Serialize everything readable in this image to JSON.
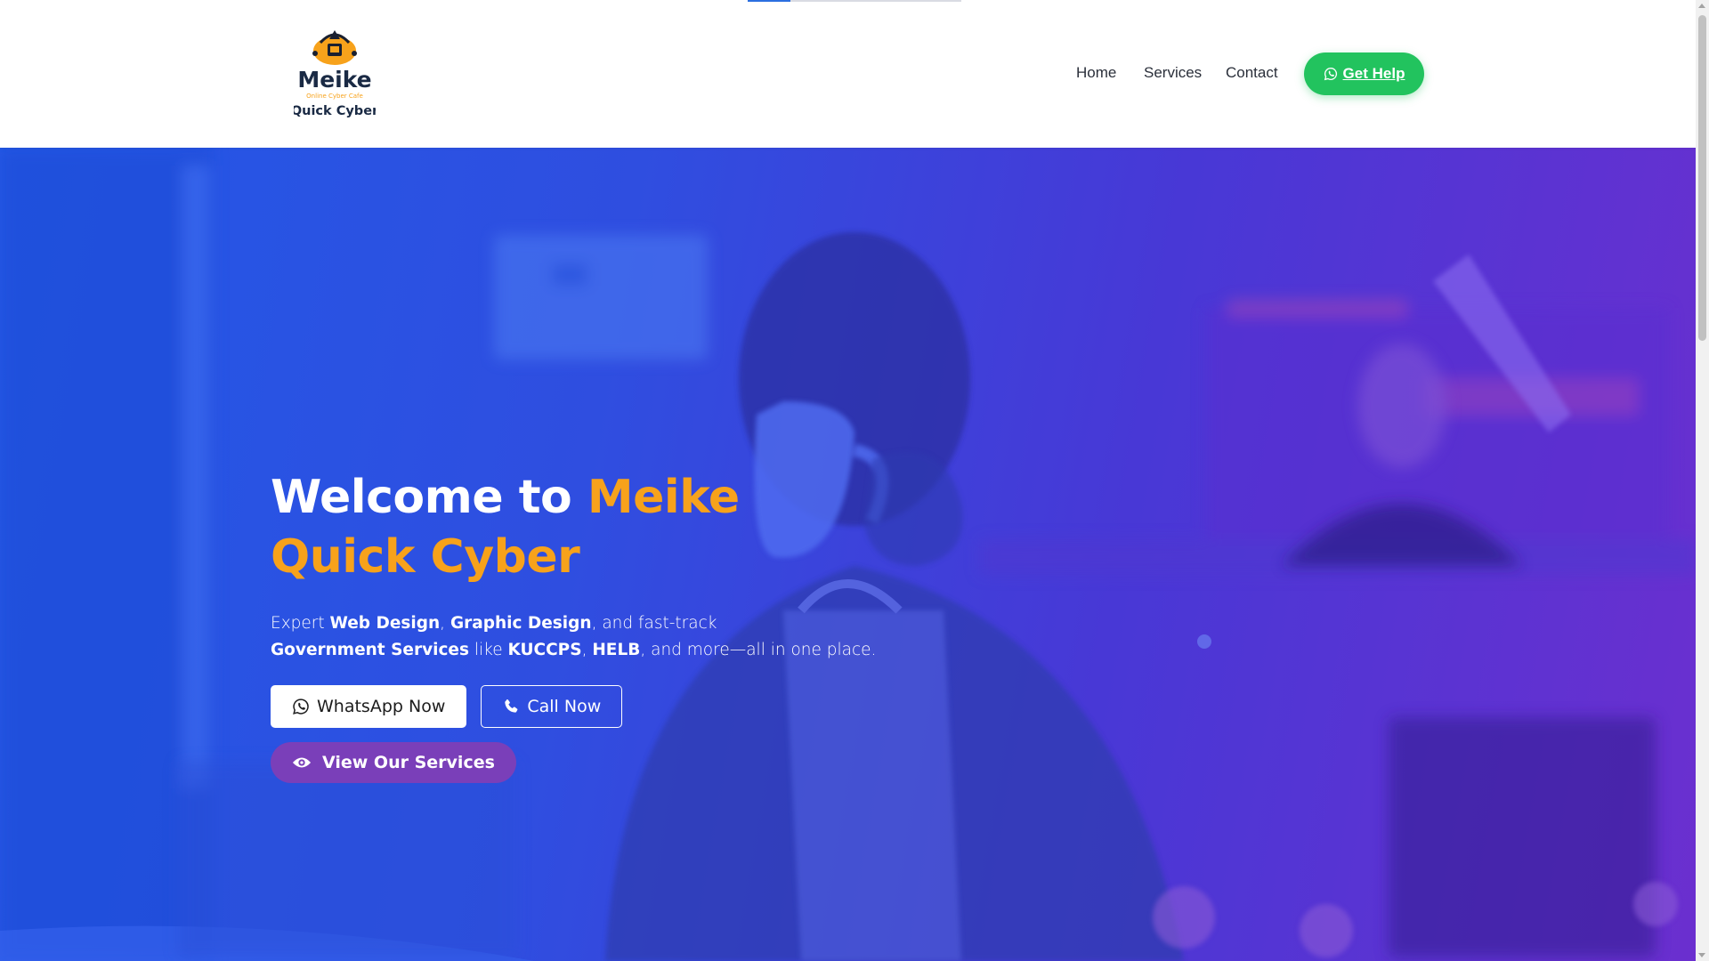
{
  "page_progress": 0.2,
  "header": {
    "logo": {
      "name_line1": "Meike",
      "tagline": "Online Cyber Cafe",
      "name_line2": "Quick Cyber"
    },
    "nav": [
      {
        "label": "Home"
      },
      {
        "label": "Services"
      },
      {
        "label": "Contact"
      }
    ],
    "get_help_label": "Get Help"
  },
  "hero": {
    "title_prefix": "Welcome to ",
    "title_accent": "Meike Quick Cyber",
    "description": {
      "t1": "Expert ",
      "b1": "Web Design",
      "t2": ", ",
      "b2": "Graphic Design",
      "t3": ", and fast-track",
      "b3": "Government Services",
      "t4": " like ",
      "b4": "KUCCPS",
      "t5": ", ",
      "b5": "HELB",
      "t6": ", and more—all in one place."
    },
    "whatsapp_label": "WhatsApp Now",
    "call_label": "Call Now",
    "services_label": "View Our Services"
  },
  "icons": {
    "whatsapp": "whatsapp-icon",
    "phone": "phone-icon",
    "eye": "eye-icon"
  },
  "colors": {
    "accent_orange": "#f7a21b",
    "whatsapp_green": "#22c35e",
    "hero_blue": "#2358e6",
    "hero_purple": "#6b2fcf",
    "services_button": "#7a3fb9"
  }
}
